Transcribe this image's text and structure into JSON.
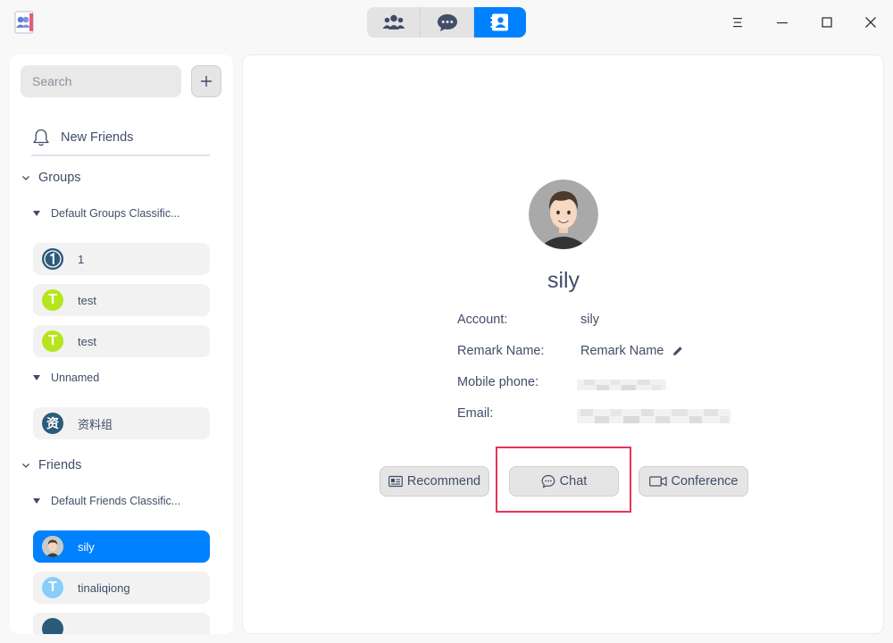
{
  "titlebar": {
    "tabs": [
      {
        "icon": "group-icon",
        "active": false
      },
      {
        "icon": "chat-bubble-icon",
        "active": false
      },
      {
        "icon": "contact-card-icon",
        "active": true
      }
    ],
    "accent": "#0081ff"
  },
  "sidebar": {
    "search_placeholder": "Search",
    "new_friends_label": "New Friends",
    "groups_label": "Groups",
    "groups_sections": [
      {
        "label": "Default Groups Classific...",
        "items": [
          {
            "name": "1",
            "avatar_letter": "1",
            "avatar_color": "#2c5b7a"
          },
          {
            "name": "test",
            "avatar_letter": "T",
            "avatar_color": "#b5e61d"
          },
          {
            "name": "test",
            "avatar_letter": "T",
            "avatar_color": "#b5e61d"
          }
        ]
      },
      {
        "label": "Unnamed",
        "items": [
          {
            "name": "资料组",
            "avatar_letter": "资",
            "avatar_color": "#2c5b7a"
          }
        ]
      }
    ],
    "friends_label": "Friends",
    "friends_sections": [
      {
        "label": "Default Friends Classific...",
        "items": [
          {
            "name": "sily",
            "selected": true
          },
          {
            "name": "tinaliqiong",
            "avatar_letter": "T",
            "avatar_color": "#87cefa"
          }
        ]
      }
    ]
  },
  "profile": {
    "name": "sily",
    "fields": {
      "account_label": "Account:",
      "account_value": "sily",
      "remark_label": "Remark Name:",
      "remark_value": "Remark Name",
      "mobile_label": "Mobile phone:",
      "email_label": "Email:"
    },
    "actions": {
      "recommend": "Recommend",
      "chat": "Chat",
      "conference": "Conference"
    },
    "highlight_color": "#e8345a"
  }
}
